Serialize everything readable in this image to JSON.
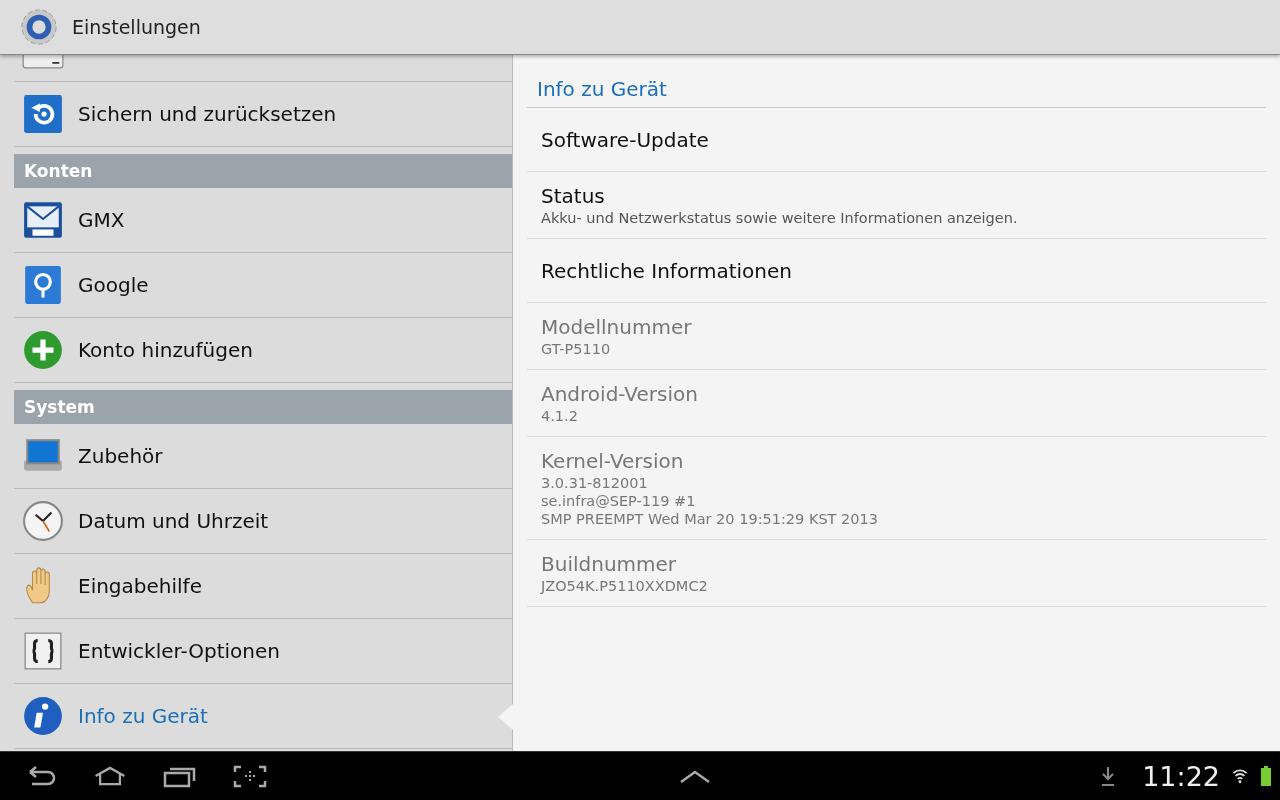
{
  "action_bar": {
    "title": "Einstellungen"
  },
  "sidebar": [
    {
      "kind": "partial"
    },
    {
      "kind": "item",
      "label": "Sichern und zurücksetzen",
      "selected": false
    },
    {
      "kind": "header",
      "label": "Konten"
    },
    {
      "kind": "item",
      "label": "GMX",
      "selected": false
    },
    {
      "kind": "item",
      "label": "Google",
      "selected": false
    },
    {
      "kind": "item",
      "label": "Konto hinzufügen",
      "selected": false
    },
    {
      "kind": "header",
      "label": "System"
    },
    {
      "kind": "item",
      "label": "Zubehör",
      "selected": false
    },
    {
      "kind": "item",
      "label": "Datum und Uhrzeit",
      "selected": false
    },
    {
      "kind": "item",
      "label": "Eingabehilfe",
      "selected": false
    },
    {
      "kind": "item",
      "label": "Entwickler-Optionen",
      "selected": false
    },
    {
      "kind": "item",
      "label": "Info zu Gerät",
      "selected": true
    }
  ],
  "detail": {
    "title": "Info zu Gerät",
    "items": [
      {
        "title": "Software-Update",
        "disabled": false
      },
      {
        "title": "Status",
        "summary": [
          "Akku- und Netzwerkstatus sowie weitere Informationen anzeigen."
        ],
        "disabled": false
      },
      {
        "title": "Rechtliche Informationen",
        "disabled": false
      },
      {
        "title": "Modellnummer",
        "summary": [
          "GT-P5110"
        ],
        "disabled": true
      },
      {
        "title": "Android-Version",
        "summary": [
          "4.1.2"
        ],
        "disabled": true
      },
      {
        "title": "Kernel-Version",
        "summary": [
          "3.0.31-812001",
          "se.infra@SEP-119 #1",
          "SMP PREEMPT Wed Mar 20 19:51:29 KST 2013"
        ],
        "disabled": true
      },
      {
        "title": "Buildnummer",
        "summary": [
          "JZO54K.P5110XXDMC2"
        ],
        "disabled": true
      }
    ]
  },
  "system_bar": {
    "clock": "11:22"
  }
}
